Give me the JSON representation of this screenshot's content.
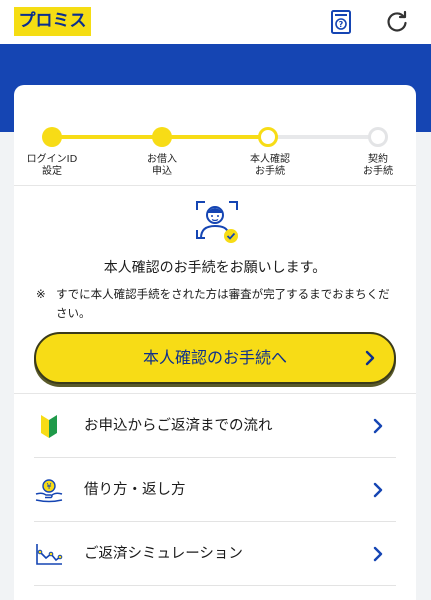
{
  "header": {
    "logo_text": "プロミス",
    "help_icon": "help-document-icon",
    "refresh_icon": "refresh-icon"
  },
  "colors": {
    "brand_yellow": "#f7dc16",
    "brand_blue": "#1545b3",
    "text_blue": "#0d2f8d"
  },
  "progress": {
    "steps": [
      {
        "label": "ログインID\n設定",
        "state": "done"
      },
      {
        "label": "お借入\n申込",
        "state": "done"
      },
      {
        "label": "本人確認\nお手続",
        "state": "current"
      },
      {
        "label": "契約\nお手続",
        "state": "todo"
      }
    ]
  },
  "verification": {
    "icon": "person-verified-icon",
    "message": "本人確認のお手続をお願いします。",
    "note_mark": "※",
    "note_text": "すでに本人確認手続をされた方は審査が完了するまでおまちください。",
    "button_label": "本人確認のお手続へ"
  },
  "menu": [
    {
      "label": "お申込からご返済までの流れ",
      "icon": "beginner-mark-icon"
    },
    {
      "label": "借り方・返し方",
      "icon": "yen-hand-icon"
    },
    {
      "label": "ご返済シミュレーション",
      "icon": "line-chart-icon"
    }
  ]
}
